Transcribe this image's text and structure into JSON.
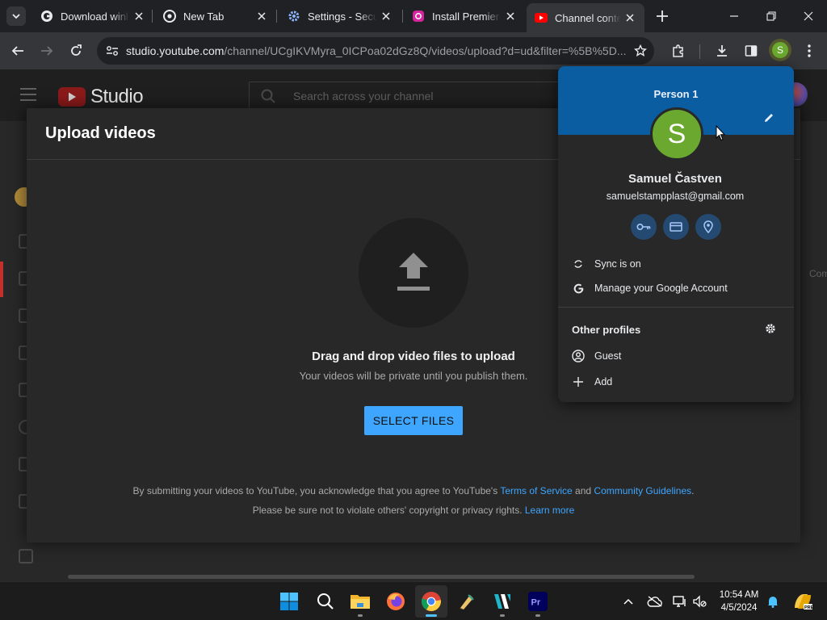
{
  "browser": {
    "tabs": [
      {
        "title": "Download winl",
        "icon": "google-icon"
      },
      {
        "title": "New Tab",
        "icon": "chrome-icon"
      },
      {
        "title": "Settings - Secu",
        "icon": "settings-gear-icon"
      },
      {
        "title": "Install Premiere",
        "icon": "instagram-icon"
      },
      {
        "title": "Channel conte",
        "icon": "youtube-icon",
        "active": true
      }
    ],
    "url_host": "studio.youtube.com",
    "url_path": "/channel/UCgIKVMyra_0ICPoa02dGz8Q/videos/upload?d=ud&filter=%5B%5D...",
    "profile_initial": "S"
  },
  "studio": {
    "logo_text": "Studio",
    "search_placeholder": "Search across your channel",
    "right_peek": "Com"
  },
  "upload": {
    "title": "Upload videos",
    "drag_title": "Drag and drop video files to upload",
    "drag_sub": "Your videos will be private until you publish them.",
    "button": "SELECT FILES",
    "legal_prefix": "By submitting your videos to YouTube, you acknowledge that you agree to YouTube's ",
    "tos": "Terms of Service",
    "and": " and ",
    "guidelines": "Community Guidelines",
    "period": ".",
    "legal2_prefix": "Please be sure not to violate others' copyright or privacy rights. ",
    "learn_more": "Learn more"
  },
  "profile_menu": {
    "person": "Person 1",
    "avatar_initial": "S",
    "name": "Samuel Častven",
    "email": "samuelstampplast@gmail.com",
    "sync": "Sync is on",
    "manage": "Manage your Google Account",
    "other_profiles": "Other profiles",
    "guest": "Guest",
    "add": "Add"
  },
  "taskbar": {
    "apps": [
      "start-icon",
      "search-icon",
      "file-explorer-icon",
      "firefox-icon",
      "chrome-icon",
      "app-icon",
      "filmora-icon",
      "premiere-pro-icon"
    ],
    "time": "10:54 AM",
    "date": "4/5/2024"
  },
  "colors": {
    "accent_blue": "#3ea6ff",
    "profile_banner": "#0b5da1",
    "avatar_green": "#6aa82f",
    "youtube_red": "#ff0000"
  }
}
